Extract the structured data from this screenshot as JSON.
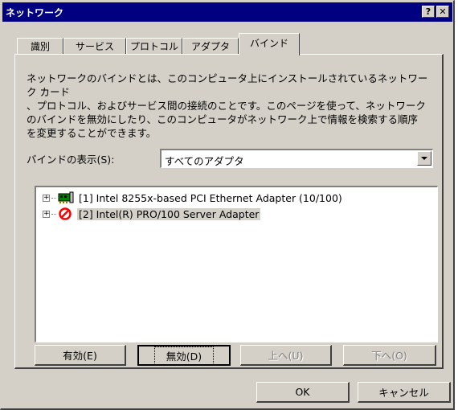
{
  "window": {
    "title": "ネットワーク",
    "help_glyph": "?",
    "close_glyph": "✕"
  },
  "tabs": [
    {
      "label": "識別",
      "active": false
    },
    {
      "label": "サービス",
      "active": false
    },
    {
      "label": "プロトコル",
      "active": false
    },
    {
      "label": "アダプタ",
      "active": false
    },
    {
      "label": "バインド",
      "active": true
    }
  ],
  "description": "ネットワークのバインドとは、このコンピュータ上にインストールされているネットワーク カード\n、プロトコル、およびサービス間の接続のことです。このページを使って、ネットワーク\nのバインドを無効にしたり、このコンピュータがネットワーク上で情報を検索する順序\nを変更することができます。",
  "bindings_view": {
    "label": "バインドの表示(S):",
    "selected": "すべてのアダプタ"
  },
  "tree": [
    {
      "expander": "+",
      "icon": "network-adapter-icon",
      "label": "[1] Intel 8255x-based PCI Ethernet Adapter (10/100)",
      "selected": false
    },
    {
      "expander": "+",
      "icon": "disabled-icon",
      "label": "[2] Intel(R) PRO/100 Server Adapter",
      "selected": true
    }
  ],
  "buttons": {
    "enable": "有効(E)",
    "disable": "無効(D)",
    "up": "上へ(U)",
    "down": "下へ(O)",
    "ok": "OK",
    "cancel": "キャンセル"
  }
}
